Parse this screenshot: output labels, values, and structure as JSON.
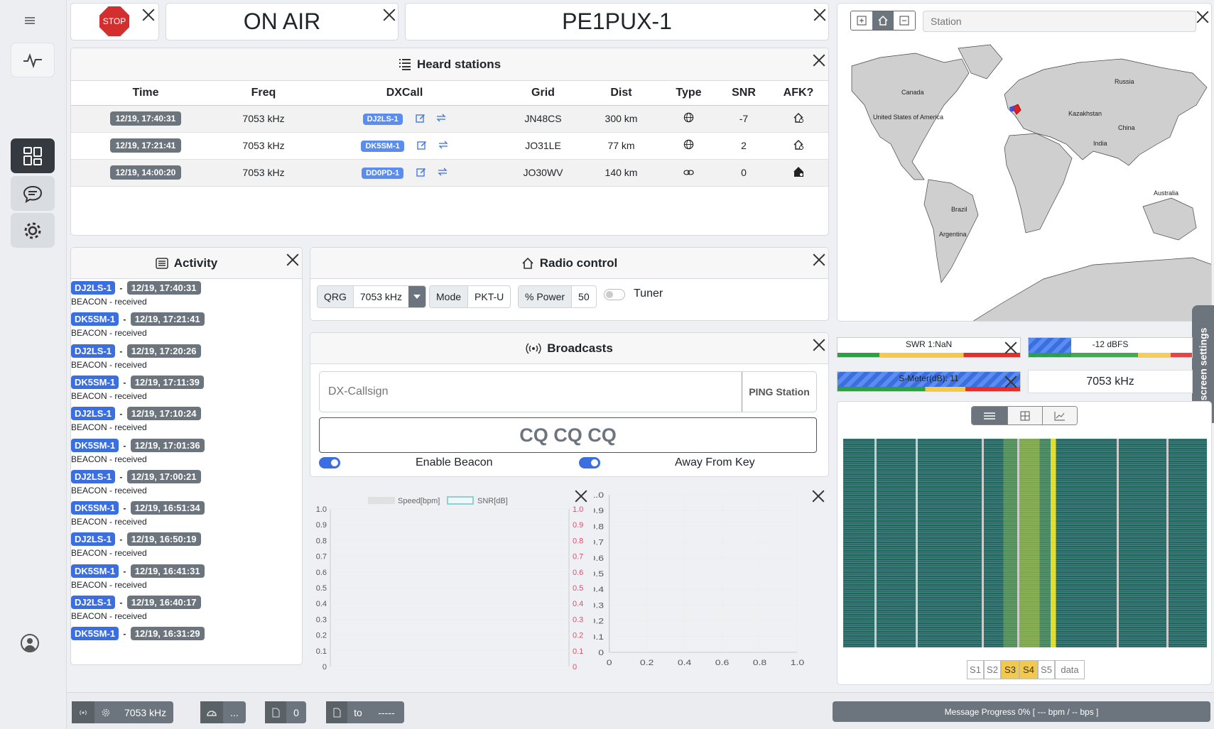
{
  "header": {
    "stop_label": "STOP",
    "status": "ON AIR",
    "callsign": "PE1PUX-1"
  },
  "heard": {
    "title": "Heard stations",
    "columns": [
      "Time",
      "Freq",
      "DXCall",
      "Grid",
      "Dist",
      "Type",
      "SNR",
      "AFK?"
    ],
    "rows": [
      {
        "time": "12/19, 17:40:31",
        "freq": "7053 kHz",
        "call": "DJ2LS-1",
        "grid": "JN48CS",
        "dist": "300 km",
        "type": "globe",
        "snr": "-7",
        "afk": "house-outline"
      },
      {
        "time": "12/19, 17:21:41",
        "freq": "7053 kHz",
        "call": "DK5SM-1",
        "grid": "JO31LE",
        "dist": "77 km",
        "type": "globe",
        "snr": "2",
        "afk": "house-outline"
      },
      {
        "time": "12/19, 14:00:20",
        "freq": "7053 kHz",
        "call": "DD0PD-1",
        "grid": "JO30WV",
        "dist": "140 km",
        "type": "link",
        "snr": "0",
        "afk": "house-filled"
      }
    ]
  },
  "activity": {
    "title": "Activity",
    "items": [
      {
        "call": "DJ2LS-1",
        "time": "12/19, 17:40:31",
        "text": "BEACON - received"
      },
      {
        "call": "DK5SM-1",
        "time": "12/19, 17:21:41",
        "text": "BEACON - received"
      },
      {
        "call": "DJ2LS-1",
        "time": "12/19, 17:20:26",
        "text": "BEACON - received"
      },
      {
        "call": "DK5SM-1",
        "time": "12/19, 17:11:39",
        "text": "BEACON - received"
      },
      {
        "call": "DJ2LS-1",
        "time": "12/19, 17:10:24",
        "text": "BEACON - received"
      },
      {
        "call": "DK5SM-1",
        "time": "12/19, 17:01:36",
        "text": "BEACON - received"
      },
      {
        "call": "DJ2LS-1",
        "time": "12/19, 17:00:21",
        "text": "BEACON - received"
      },
      {
        "call": "DK5SM-1",
        "time": "12/19, 16:51:34",
        "text": "BEACON - received"
      },
      {
        "call": "DJ2LS-1",
        "time": "12/19, 16:50:19",
        "text": "BEACON - received"
      },
      {
        "call": "DK5SM-1",
        "time": "12/19, 16:41:31",
        "text": "BEACON - received"
      },
      {
        "call": "DJ2LS-1",
        "time": "12/19, 16:40:17",
        "text": "BEACON - received"
      },
      {
        "call": "DK5SM-1",
        "time": "12/19, 16:31:29",
        "text": ""
      }
    ]
  },
  "radio": {
    "title": "Radio control",
    "qrg_label": "QRG",
    "qrg_value": "7053 kHz",
    "mode_label": "Mode",
    "mode_value": "PKT-U",
    "power_label": "% Power",
    "power_value": "50",
    "tuner_label": "Tuner"
  },
  "broadcasts": {
    "title": "Broadcasts",
    "dx_placeholder": "DX-Callsign",
    "ping_label": "PING Station",
    "cq_label": "CQ CQ CQ",
    "beacon_label": "Enable Beacon",
    "afk_label": "Away From Key"
  },
  "chart_data": [
    {
      "type": "line",
      "series": [
        {
          "name": "Speed[bpm]",
          "values": []
        },
        {
          "name": "SNR[dB]",
          "values": []
        }
      ],
      "ylim": [
        0,
        1
      ],
      "y2lim": [
        0,
        1
      ],
      "yticks": [
        "1.0",
        "0.9",
        "0.8",
        "0.7",
        "0.6",
        "0.5",
        "0.4",
        "0.3",
        "0.2",
        "0.1",
        "0"
      ],
      "colors": {
        "speed": "#e0e0e0",
        "snr": "#8fd0d0",
        "y2": "#e04e6a"
      }
    },
    {
      "type": "scatter",
      "series": [],
      "xlim": [
        0,
        1
      ],
      "ylim": [
        0,
        1
      ],
      "yticks": [
        "1.0",
        "0.9",
        "0.8",
        "0.7",
        "0.6",
        "0.5",
        "0.4",
        "0.3",
        "0.2",
        "0.1",
        "0"
      ],
      "xticks": [
        "0",
        "0.2",
        "0.4",
        "0.6",
        "0.8",
        "1.0"
      ]
    }
  ],
  "map": {
    "search_placeholder": "Station",
    "labels": [
      "Canada",
      "United States of America",
      "Brazil",
      "Argentina",
      "Russia",
      "Kazakhstan",
      "China",
      "India",
      "Australia"
    ]
  },
  "meters": {
    "swr": "SWR 1:NaN",
    "dbfs": "-12 dBFS",
    "smeter": "S-Meter(dB): 11",
    "freq": "7053 kHz"
  },
  "waterfall": {
    "segments": [
      "S1",
      "S2",
      "S3",
      "S4",
      "S5",
      "data"
    ]
  },
  "side_tab": "screen settings",
  "footer": {
    "freq": "7053 kHz",
    "speed": "...",
    "count": "0",
    "to_label": "to",
    "to_value": "-----",
    "progress": "Message Progress 0% [ --- bpm / -- bps ]"
  }
}
